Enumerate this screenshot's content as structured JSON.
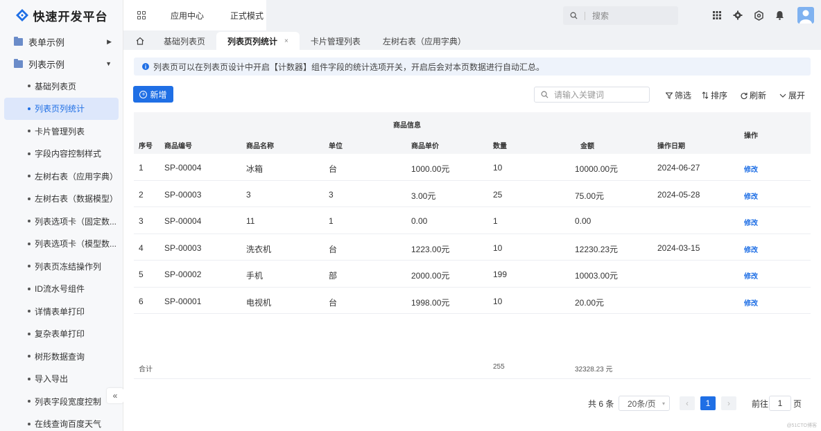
{
  "app": {
    "title": "快速开发平台"
  },
  "topnav": {
    "app_center": "应用中心",
    "mode": "正式模式",
    "search_placeholder": "搜索"
  },
  "sidebar": {
    "groups": [
      {
        "label": "表单示例",
        "expanded": false
      },
      {
        "label": "列表示例",
        "expanded": true
      }
    ],
    "items": [
      {
        "label": "基础列表页"
      },
      {
        "label": "列表页列统计"
      },
      {
        "label": "卡片管理列表"
      },
      {
        "label": "字段内容控制样式"
      },
      {
        "label": "左树右表（应用字典）"
      },
      {
        "label": "左树右表（数据模型）"
      },
      {
        "label": "列表选项卡（固定数..."
      },
      {
        "label": "列表选项卡（模型数..."
      },
      {
        "label": "列表页冻结操作列"
      },
      {
        "label": "ID流水号组件"
      },
      {
        "label": "详情表单打印"
      },
      {
        "label": "复杂表单打印"
      },
      {
        "label": "树形数据查询"
      },
      {
        "label": "导入导出"
      },
      {
        "label": "列表字段宽度控制"
      },
      {
        "label": "在线查询百度天气"
      }
    ],
    "active_index": 1,
    "collapse_glyph": "«"
  },
  "tabs": [
    {
      "label": "基础列表页"
    },
    {
      "label": "列表页列统计",
      "active": true,
      "close": "×"
    },
    {
      "label": "卡片管理列表"
    },
    {
      "label": "左树右表（应用字典）"
    }
  ],
  "notice": {
    "text": "列表页可以在列表页设计中开启【计数器】组件字段的统计选项开关，开启后会对本页数据进行自动汇总。"
  },
  "toolbar": {
    "add_label": "新增",
    "keyword_placeholder": "请输入关键词",
    "filter_label": "筛选",
    "sort_label": "排序",
    "refresh_label": "刷新",
    "expand_label": "展开"
  },
  "table": {
    "group_title": "商品信息",
    "columns": [
      "序号",
      "商品编号",
      "商品名称",
      "单位",
      "商品单价",
      "数量",
      "金额",
      "操作日期"
    ],
    "op_header": "操作",
    "rows": [
      {
        "seq": "1",
        "code": "SP-00004",
        "name": "冰箱",
        "unit": "台",
        "price": "1000.00元",
        "qty": "10",
        "amount": "10000.00元",
        "date": "2024-06-27",
        "op": "修改"
      },
      {
        "seq": "2",
        "code": "SP-00003",
        "name": "3",
        "unit": "3",
        "price": "3.00元",
        "qty": "25",
        "amount": "75.00元",
        "date": "2024-05-28",
        "op": "修改"
      },
      {
        "seq": "3",
        "code": "SP-00004",
        "name": "11",
        "unit": "1",
        "price": "0.00",
        "qty": "1",
        "amount": "0.00",
        "date": "",
        "op": "修改"
      },
      {
        "seq": "4",
        "code": "SP-00003",
        "name": "洗衣机",
        "unit": "台",
        "price": "1223.00元",
        "qty": "10",
        "amount": "12230.23元",
        "date": "2024-03-15",
        "op": "修改"
      },
      {
        "seq": "5",
        "code": "SP-00002",
        "name": "手机",
        "unit": "部",
        "price": "2000.00元",
        "qty": "199",
        "amount": "10003.00元",
        "date": "",
        "op": "修改"
      },
      {
        "seq": "6",
        "code": "SP-00001",
        "name": "电视机",
        "unit": "台",
        "price": "1998.00元",
        "qty": "10",
        "amount": "20.00元",
        "date": "",
        "op": "修改"
      }
    ],
    "summary": {
      "label": "合计",
      "qty": "255",
      "amount": "32328.23 元"
    }
  },
  "pager": {
    "total": "共 6 条",
    "page_size": "20条/页",
    "prev": "‹",
    "next": "›",
    "current": "1",
    "goto_label": "前往",
    "goto_value": "1",
    "page_suffix": "页"
  },
  "watermark": "@51CTO博客",
  "colors": {
    "accent": "#1f6fe5",
    "active_bg": "#dde7fb"
  }
}
